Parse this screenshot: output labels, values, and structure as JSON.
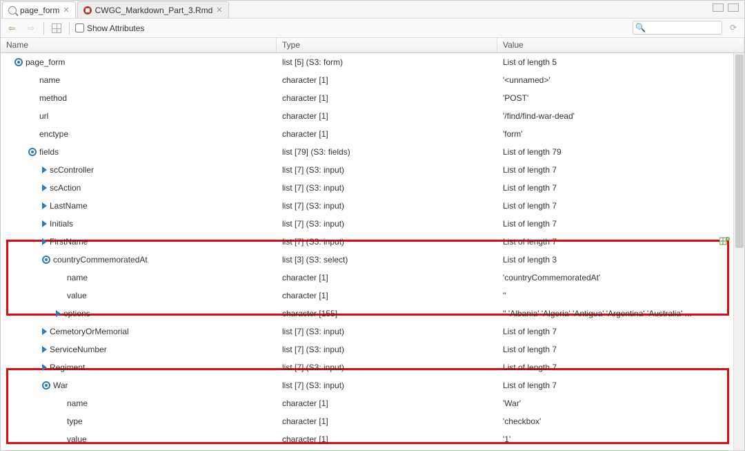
{
  "tabs": [
    {
      "label": "page_form",
      "icon": "search-icon",
      "active": true
    },
    {
      "label": "CWGC_Markdown_Part_3.Rmd",
      "icon": "knit-icon",
      "active": false
    }
  ],
  "toolbar": {
    "show_attributes_label": "Show Attributes",
    "search_placeholder": ""
  },
  "columns": {
    "name": "Name",
    "type": "Type",
    "value": "Value"
  },
  "rows": [
    {
      "indent": 1,
      "icon": "expander-open",
      "name": "page_form",
      "type": "list [5] (S3: form)",
      "value": "List of length 5"
    },
    {
      "indent": 2,
      "icon": "",
      "name": "name",
      "type": "character [1]",
      "value": "'<unnamed>'"
    },
    {
      "indent": 2,
      "icon": "",
      "name": "method",
      "type": "character [1]",
      "value": "'POST'"
    },
    {
      "indent": 2,
      "icon": "",
      "name": "url",
      "type": "character [1]",
      "value": "'/find/find-war-dead'"
    },
    {
      "indent": 2,
      "icon": "",
      "name": "enctype",
      "type": "character [1]",
      "value": "'form'"
    },
    {
      "indent": 2,
      "icon": "expander-open",
      "name": "fields",
      "type": "list [79] (S3: fields)",
      "value": "List of length 79"
    },
    {
      "indent": 3,
      "icon": "expander-closed",
      "name": "scController",
      "type": "list [7] (S3: input)",
      "value": "List of length 7"
    },
    {
      "indent": 3,
      "icon": "expander-closed",
      "name": "scAction",
      "type": "list [7] (S3: input)",
      "value": "List of length 7"
    },
    {
      "indent": 3,
      "icon": "expander-closed",
      "name": "LastName",
      "type": "list [7] (S3: input)",
      "value": "List of length 7"
    },
    {
      "indent": 3,
      "icon": "expander-closed",
      "name": "Initials",
      "type": "list [7] (S3: input)",
      "value": "List of length 7"
    },
    {
      "indent": 3,
      "icon": "expander-closed",
      "name": "FirstName",
      "type": "list [7] (S3: input)",
      "value": "List of length 7",
      "action": "new-var"
    },
    {
      "indent": 3,
      "icon": "expander-open",
      "name": "countryCommemoratedAt",
      "type": "list [3] (S3: select)",
      "value": "List of length 3"
    },
    {
      "indent": 4,
      "icon": "",
      "name": "name",
      "type": "character [1]",
      "value": "'countryCommemoratedAt'"
    },
    {
      "indent": 4,
      "icon": "",
      "name": "value",
      "type": "character [1]",
      "value": "''"
    },
    {
      "indent": 4,
      "icon": "expander-closed",
      "name": "options",
      "type": "character [155]",
      "value": "'' 'Albania' 'Algeria' 'Antigua' 'Argentina' 'Australia' ..."
    },
    {
      "indent": 3,
      "icon": "expander-closed",
      "name": "CemetoryOrMemorial",
      "type": "list [7] (S3: input)",
      "value": "List of length 7"
    },
    {
      "indent": 3,
      "icon": "expander-closed",
      "name": "ServiceNumber",
      "type": "list [7] (S3: input)",
      "value": "List of length 7"
    },
    {
      "indent": 3,
      "icon": "expander-closed",
      "name": "Regiment",
      "type": "list [7] (S3: input)",
      "value": "List of length 7"
    },
    {
      "indent": 3,
      "icon": "expander-open",
      "name": "War",
      "type": "list [7] (S3: input)",
      "value": "List of length 7"
    },
    {
      "indent": 4,
      "icon": "",
      "name": "name",
      "type": "character [1]",
      "value": "'War'"
    },
    {
      "indent": 4,
      "icon": "",
      "name": "type",
      "type": "character [1]",
      "value": "'checkbox'"
    },
    {
      "indent": 4,
      "icon": "",
      "name": "value",
      "type": "character [1]",
      "value": "'1'"
    }
  ]
}
